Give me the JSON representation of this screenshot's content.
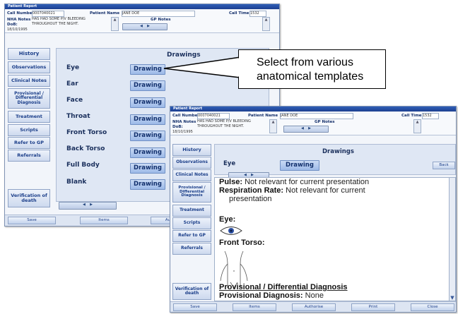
{
  "window1": {
    "title": "Patient Report",
    "call_number_label": "Call Number",
    "call_number": "0007040021",
    "patient_name_label": "Patient Name",
    "patient_name": "JANE DOE",
    "call_time_label": "Call Time",
    "call_time": "1532",
    "nha_notes_label": "NHA Notes",
    "dob_label": "DoB:",
    "dob": "18/10/1995",
    "nha_notes": "HAS HAD SOME P/V BLEEDING\nTHROUGHOUT THE NIGHT.",
    "gp_notes_label": "GP Notes",
    "sidebar": [
      "History",
      "Observations",
      "Clinical Notes",
      "Provisional / Differential Diagnosis",
      "Treatment",
      "Scripts",
      "Refer to GP",
      "Referrals"
    ],
    "verification": "Verification of death",
    "drawings_heading": "Drawings",
    "drawing_rows": [
      "Eye",
      "Ear",
      "Face",
      "Throat",
      "Front Torso",
      "Back Torso",
      "Full Body",
      "Blank"
    ],
    "drawing_button": "Drawing",
    "bottom_buttons": [
      "Save",
      "Items",
      "Authorise"
    ]
  },
  "callout": {
    "line1": "Select from various",
    "line2": "anatomical templates"
  },
  "window2": {
    "title": "Patient Report",
    "call_number_label": "Call Number",
    "call_number": "0007040021",
    "patient_name_label": "Patient Name",
    "patient_name": "JANE DOE",
    "call_time_label": "Call Time",
    "call_time": "1532",
    "nha_notes_label": "NHA Notes",
    "dob_label": "DoB:",
    "dob": "18/10/1995",
    "nha_notes": "HAS HAD SOME P/V BLEEDING\nTHROUGHOUT THE NIGHT.",
    "gp_notes_label": "GP Notes",
    "sidebar": [
      "History",
      "Observations",
      "Clinical Notes",
      "Provisional / Differential Diagnosis",
      "Treatment",
      "Scripts",
      "Refer to GP",
      "Referrals"
    ],
    "verification": "Verification of death",
    "drawings_heading": "Drawings",
    "selected_row": "Eye",
    "drawing_button": "Drawing",
    "back_button": "Back",
    "report": {
      "pulse_label": "Pulse:",
      "pulse_value": "Not relevant for current presentation",
      "resp_label": "Respiration Rate:",
      "resp_value": "Not relevant for current",
      "resp_value2": "presentation",
      "eye_label": "Eye:",
      "front_torso_label": "Front Torso:",
      "prov_heading": "Provisional / Differential Diagnosis",
      "prov_label": "Provisional Diagnosis:",
      "prov_value": "None"
    },
    "bottom_buttons": [
      "Save",
      "Items",
      "Authorise",
      "Print",
      "Close"
    ]
  },
  "colors": {
    "titlebar": "#1d3f8f",
    "button_text": "#1c3f8a",
    "drawing_button": "#9cb9e8"
  }
}
